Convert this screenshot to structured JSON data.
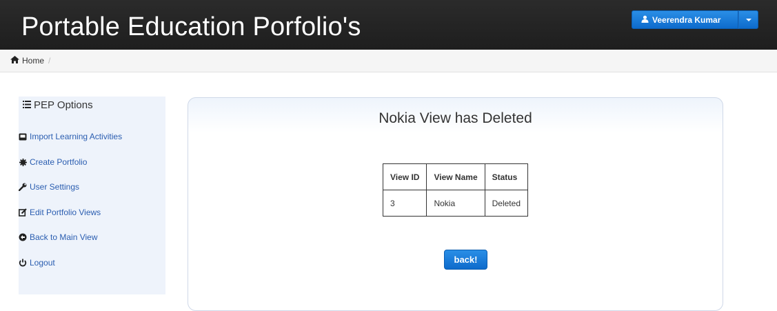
{
  "header": {
    "brand": "Portable Education Porfolio's",
    "user_name": "Veerendra Kumar"
  },
  "breadcrumb": {
    "home_label": "Home",
    "separator": "/"
  },
  "sidebar": {
    "title": "PEP Options",
    "items": [
      {
        "label": "Import Learning Activities",
        "icon": "hdd-icon"
      },
      {
        "label": "Create Portfolio",
        "icon": "gear-icon"
      },
      {
        "label": "User Settings",
        "icon": "wrench-icon"
      },
      {
        "label": "Edit Portfolio Views",
        "icon": "edit-icon"
      },
      {
        "label": "Back to Main View",
        "icon": "arrow-circle-left-icon"
      },
      {
        "label": "Logout",
        "icon": "power-icon"
      }
    ]
  },
  "main": {
    "title": "Nokia View has Deleted",
    "table": {
      "headers": [
        "View ID",
        "View Name",
        "Status"
      ],
      "rows": [
        [
          "3",
          "Nokia",
          "Deleted"
        ]
      ]
    },
    "back_label": "back!"
  },
  "colors": {
    "accent": "#0d6bcc",
    "navbar": "#222222",
    "sidebar_bg": "#eef3fb",
    "link": "#2a5db0"
  }
}
